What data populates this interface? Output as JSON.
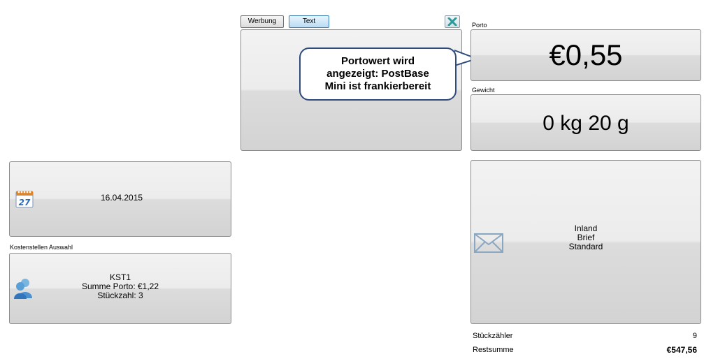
{
  "message_panel": {
    "tab_werbung": "Werbung",
    "tab_text": "Text",
    "close_icon": "close-x-icon"
  },
  "callout": {
    "line1": "Portowert wird",
    "line2": "angezeigt: PostBase",
    "line3": "Mini ist frankierbereit"
  },
  "porto": {
    "label": "Porto",
    "value": "€0,55"
  },
  "gewicht": {
    "label": "Gewicht",
    "value": "0 kg 20 g"
  },
  "date_button": {
    "icon": "calendar-icon",
    "value": "16.04.2015"
  },
  "kostenstellen": {
    "label": "Kostenstellen Auswahl",
    "icon": "user-icon",
    "name": "KST1",
    "summe": "Summe Porto: €1,22",
    "stueckzahl": "Stückzahl: 3"
  },
  "produkt": {
    "icon": "envelope-icon",
    "line1": "Inland",
    "line2": "Brief",
    "line3": "Standard"
  },
  "footer": {
    "stueckzaehler_label": "Stückzähler",
    "stueckzaehler_value": "9",
    "restsumme_label": "Restsumme",
    "restsumme_value": "€547,56"
  }
}
